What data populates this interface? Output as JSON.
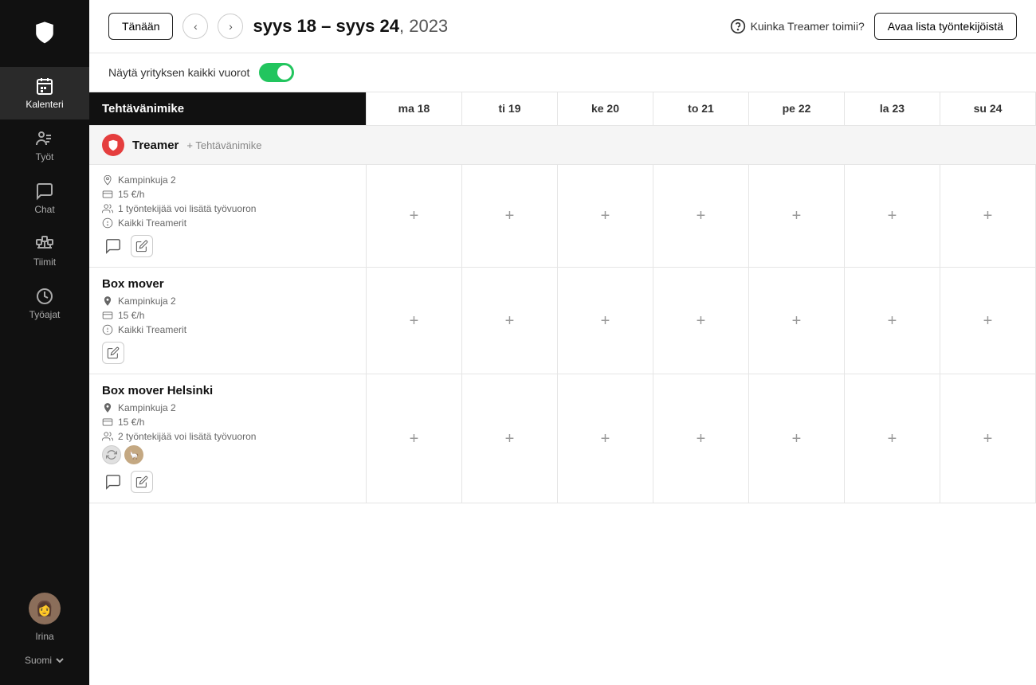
{
  "sidebar": {
    "logo_alt": "Treamer logo",
    "items": [
      {
        "id": "kalenteri",
        "label": "Kalenteri",
        "active": true
      },
      {
        "id": "tyot",
        "label": "Työt",
        "active": false
      },
      {
        "id": "chat",
        "label": "Chat",
        "active": false
      },
      {
        "id": "tiimit",
        "label": "Tiimit",
        "active": false
      },
      {
        "id": "tyoajat",
        "label": "Työajat",
        "active": false
      }
    ],
    "user": {
      "name": "Irina",
      "avatar_emoji": "👩"
    },
    "lang": "Suomi"
  },
  "header": {
    "today_label": "Tänään",
    "date_range": "syys 18 – syys 24",
    "year": ", 2023",
    "help_label": "Kuinka Treamer toimii?",
    "open_list_label": "Avaa lista työntekijöistä"
  },
  "toggle_row": {
    "label": "Näytä yrityksen kaikki vuorot",
    "enabled": true
  },
  "calendar": {
    "columns": [
      {
        "id": "task",
        "label": "Tehtävänimike"
      },
      {
        "id": "ma18",
        "label": "ma 18"
      },
      {
        "id": "ti19",
        "label": "ti 19"
      },
      {
        "id": "ke20",
        "label": "ke 20"
      },
      {
        "id": "to21",
        "label": "to 21"
      },
      {
        "id": "pe22",
        "label": "pe 22"
      },
      {
        "id": "la23",
        "label": "la 23"
      },
      {
        "id": "su24",
        "label": "su 24"
      }
    ],
    "groups": [
      {
        "id": "treamer",
        "name": "Treamer",
        "add_label": "+ Tehtävänimike",
        "tasks": [
          {
            "name": "",
            "location": "Kampinkuja 2",
            "rate": "15 €/h",
            "workers": "1 työntekijää voi lisätä työvuoron",
            "filter": "Kaikki Treamerit",
            "has_chat": true,
            "has_edit": true,
            "has_avatar": false
          }
        ]
      }
    ],
    "standalone_tasks": [
      {
        "id": "box-mover",
        "name": "Box mover",
        "location": "Kampinkuja 2",
        "rate": "15 €/h",
        "filter": "Kaikki Treamerit",
        "workers": null,
        "has_chat": false,
        "has_edit": true,
        "has_avatar": false
      },
      {
        "id": "box-mover-helsinki",
        "name": "Box mover Helsinki",
        "location": "Kampinkuja 2",
        "rate": "15 €/h",
        "workers": "2 työntekijää voi lisätä työvuoron",
        "filter": null,
        "has_chat": true,
        "has_edit": true,
        "has_avatar": true
      }
    ]
  }
}
